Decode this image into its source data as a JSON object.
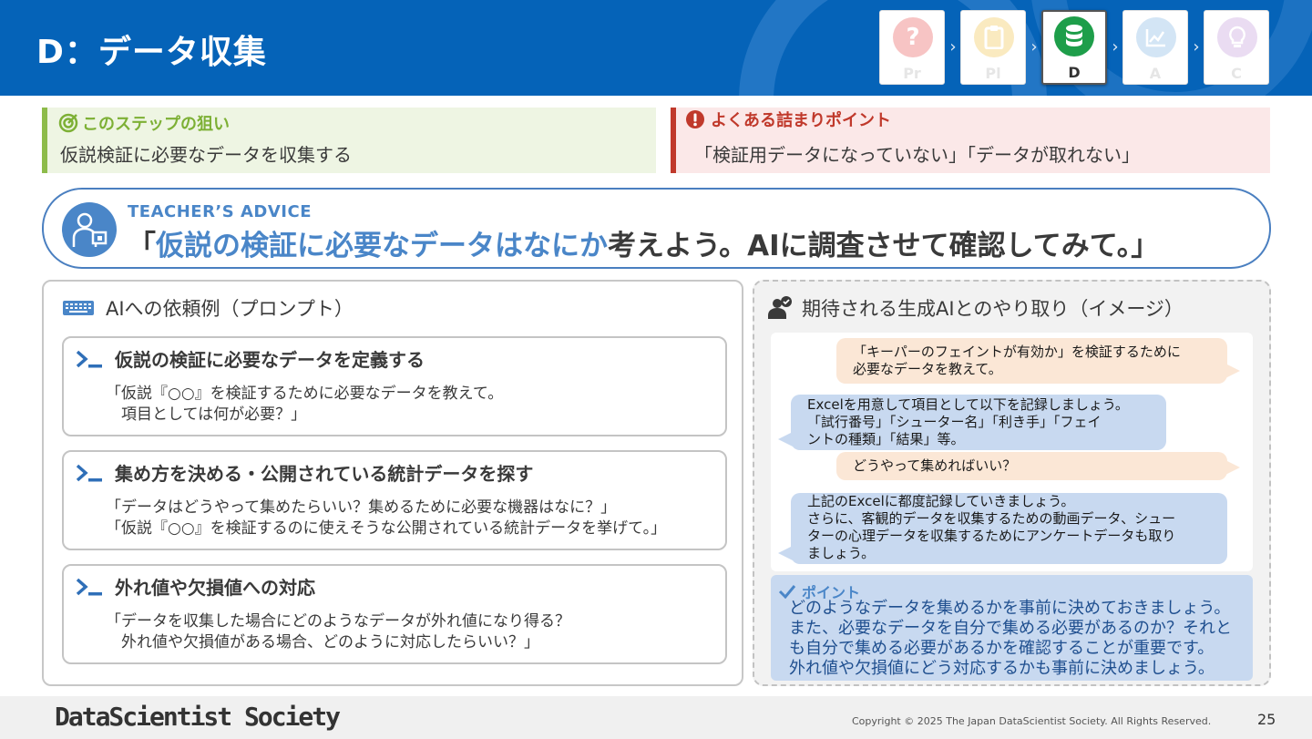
{
  "header": {
    "title": "D：データ収集",
    "steps": [
      {
        "label": "Pr",
        "icon": "question-icon",
        "color": "#f7b7b7",
        "active": false
      },
      {
        "label": "Pl",
        "icon": "clipboard-icon",
        "color": "#f8e2a8",
        "active": false
      },
      {
        "label": "D",
        "icon": "database-icon",
        "color": "#1e9e4a",
        "active": true
      },
      {
        "label": "A",
        "icon": "chart-icon",
        "color": "#c5dcf2",
        "active": false
      },
      {
        "label": "C",
        "icon": "lightbulb-icon",
        "color": "#e4d2ef",
        "active": false
      }
    ]
  },
  "aim": {
    "heading": "このステップの狙い",
    "text": "仮説検証に必要なデータを収集する"
  },
  "stuck": {
    "heading": "よくある詰まりポイント",
    "text": "「検証用データになっていない」「データが取れない」"
  },
  "advice": {
    "label": "TEACHER’S ADVICE",
    "quote_open": "「",
    "quote_highlight": "仮説の検証に必要なデータはなにか",
    "quote_rest": "考えよう。AIに調査させて確認してみて。」"
  },
  "prompts": {
    "heading": "AIへの依頼例（プロンプト）",
    "cards": [
      {
        "title": "仮説の検証に必要なデータを定義する",
        "body": "「仮説『○○』を検証するために必要なデータを教えて。\n　項目としては何が必要？」"
      },
      {
        "title": "集め方を決める・公開されている統計データを探す",
        "body": "「データはどうやって集めたらいい？集めるために必要な機器はなに？」\n「仮説『○○』を検証するのに使えそうな公開されている統計データを挙げて。」"
      },
      {
        "title": "外れ値や欠損値への対応",
        "body": "「データを収集した場合にどのようなデータが外れ値になり得る？\n　外れ値や欠損値がある場合、どのように対応したらいい？」"
      }
    ]
  },
  "chat": {
    "heading": "期待される生成AIとのやり取り（イメージ）",
    "messages": [
      {
        "role": "user",
        "text": "「キーパーのフェイントが有効か」を検証するために\n必要なデータを教えて。"
      },
      {
        "role": "ai",
        "text": "Excelを用意して項目として以下を記録しましょう。\n「試行番号」「シューター名」「利き手」「フェイ\nントの種類」「結果」等。"
      },
      {
        "role": "user",
        "text": "どうやって集めればいい？"
      },
      {
        "role": "ai",
        "text": "上記のExcelに都度記録していきましょう。\nさらに、客観的データを収集するための動画データ、シュー\nターの心理データを収集するためにアンケートデータも取り\nましょう。"
      }
    ],
    "point": {
      "heading": "ポイント",
      "text": "どのようなデータを集めるかを事前に決めておきましょう。\nまた、必要なデータを自分で集める必要があるのか？それと\nも自分で集める必要があるかを確認することが重要です。\n外れ値や欠損値にどう対応するかも事前に決めましょう。"
    }
  },
  "footer": {
    "brand": "DataScientist Society",
    "copyright": "Copyright © 2025 The Japan DataScientist Society. All Rights Reserved.",
    "page": "25"
  }
}
